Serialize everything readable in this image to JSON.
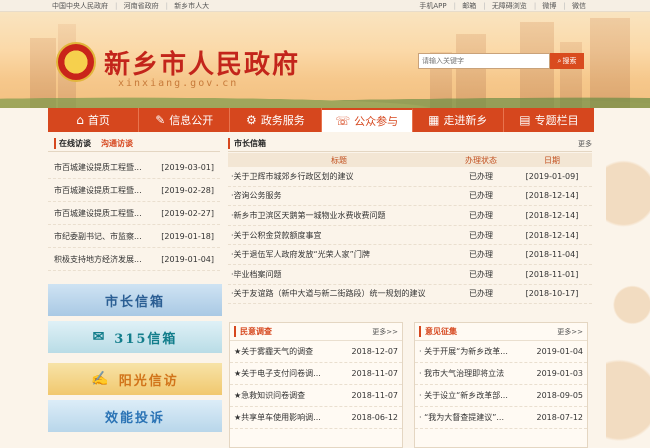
{
  "topbar": {
    "links": [
      "中国中央人民政府",
      "河南省政府",
      "新乡市人大"
    ],
    "right": [
      "手机APP",
      "邮箱",
      "无障碍浏览",
      "微博",
      "微信"
    ]
  },
  "header": {
    "title": "新乡市人民政府",
    "url": "xinxiang.gov.cn",
    "search_placeholder": "请输入关键字",
    "search_button": "搜索"
  },
  "nav": [
    {
      "label": "首页",
      "icon": "home-icon"
    },
    {
      "label": "信息公开",
      "icon": "edit-icon"
    },
    {
      "label": "政务服务",
      "icon": "service-icon"
    },
    {
      "label": "公众参与",
      "icon": "chat-icon",
      "active": true
    },
    {
      "label": "走进新乡",
      "icon": "building-icon"
    },
    {
      "label": "专题栏目",
      "icon": "document-icon"
    }
  ],
  "interview": {
    "tab_online": "在线访谈",
    "tab_review": "沟通访谈",
    "items": [
      {
        "title": "市百城建设提质工程暨...",
        "date": "[2019-03-01]"
      },
      {
        "title": "市百城建设提质工程暨...",
        "date": "[2019-02-28]"
      },
      {
        "title": "市百城建设提质工程暨...",
        "date": "[2019-02-27]"
      },
      {
        "title": "市纪委副书记、市监察...",
        "date": "[2019-01-18]"
      },
      {
        "title": "积极支持地方经济发展...",
        "date": "[2019-01-04]"
      }
    ]
  },
  "promos": [
    {
      "label": "市长信箱"
    },
    {
      "label": "315信箱"
    },
    {
      "label": "阳光信访"
    },
    {
      "label": "效能投诉"
    }
  ],
  "letters": {
    "title": "市长信箱",
    "more": "更多",
    "headers": {
      "title": "标题",
      "status": "办理状态",
      "date": "日期"
    },
    "rows": [
      {
        "title": "·关于卫辉市城郊乡行政区划的建议",
        "status": "已办理",
        "date": "[2019-01-09]"
      },
      {
        "title": "·咨询公务服务",
        "status": "已办理",
        "date": "[2018-12-14]"
      },
      {
        "title": "·新乡市卫滨区天鹅第一城物业水费收费问题",
        "status": "已办理",
        "date": "[2018-12-14]"
      },
      {
        "title": "·关于公积金贷款额度事宜",
        "status": "已办理",
        "date": "[2018-12-14]"
      },
      {
        "title": "·关于退伍军人政府发放“光荣人家”门牌",
        "status": "已办理",
        "date": "[2018-11-04]"
      },
      {
        "title": "·毕业档案问题",
        "status": "已办理",
        "date": "[2018-11-01]"
      },
      {
        "title": "·关于友谊路（新中大道与新二街路段）统一规划的建议",
        "status": "已办理",
        "date": "[2018-10-17]"
      }
    ]
  },
  "survey": {
    "title": "民意调查",
    "more": "更多>>",
    "items": [
      {
        "title": "★关于雾霾天气的调查",
        "date": "2018-12-07"
      },
      {
        "title": "★关于电子支付问卷调...",
        "date": "2018-11-07"
      },
      {
        "title": "★急救知识问卷调查",
        "date": "2018-11-07"
      },
      {
        "title": "★共享单车使用影响调...",
        "date": "2018-06-12"
      }
    ]
  },
  "opinion": {
    "title": "意见征集",
    "more": "更多>>",
    "items": [
      {
        "title": "· 关于开展“为新乡改革...",
        "date": "2019-01-04"
      },
      {
        "title": "· 我市大气治理即将立法",
        "date": "2019-01-03"
      },
      {
        "title": "· 关于设立“新乡改革部...",
        "date": "2018-09-05"
      },
      {
        "title": "· “我为大督查提建议”...",
        "date": "2018-07-12"
      }
    ]
  }
}
